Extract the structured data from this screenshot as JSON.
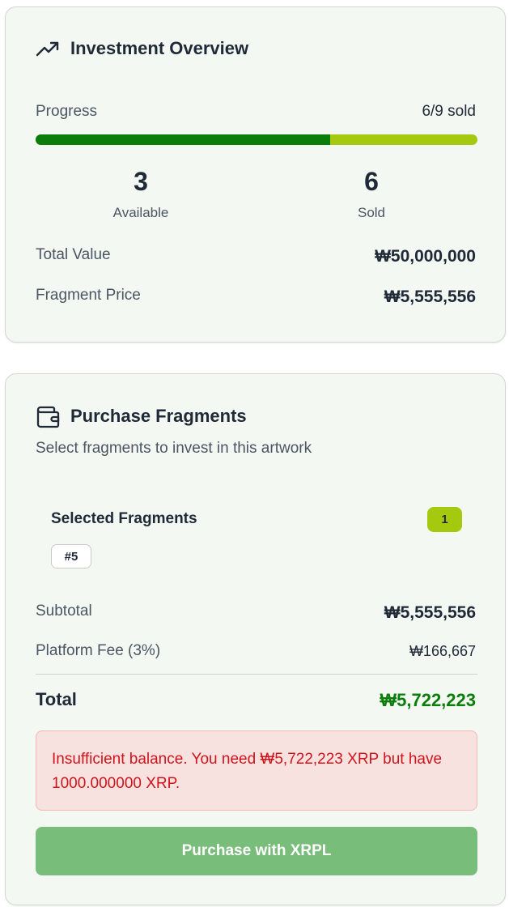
{
  "overview": {
    "icon": "trending-up-icon",
    "title": "Investment Overview",
    "progress_label": "Progress",
    "progress_text": "6/9 sold",
    "progress_fraction": 0.6667,
    "available_count": "3",
    "available_label": "Available",
    "sold_count": "6",
    "sold_label": "Sold",
    "total_value_label": "Total Value",
    "total_value": "₩50,000,000",
    "fragment_price_label": "Fragment Price",
    "fragment_price": "₩5,555,556",
    "colors": {
      "progress_sold": "#0a7d0a",
      "progress_remaining": "#a5c90f"
    }
  },
  "purchase": {
    "icon": "wallet-icon",
    "title": "Purchase Fragments",
    "subtitle": "Select fragments to invest in this artwork",
    "selected_label": "Selected Fragments",
    "selected_count": "1",
    "selected_fragments": [
      "#5"
    ],
    "subtotal_label": "Subtotal",
    "subtotal": "₩5,555,556",
    "fee_label": "Platform Fee (3%)",
    "fee": "₩166,667",
    "total_label": "Total",
    "total": "₩5,722,223",
    "error_message": "Insufficient balance. You need ₩5,722,223 XRP but have 1000.000000 XRP.",
    "button_label": "Purchase with XRPL",
    "colors": {
      "total": "#0a7d0a",
      "error_text": "#d0141b",
      "error_bg": "#f8e2e0",
      "button_bg": "#79bd7a",
      "badge": "#a5c90f"
    }
  }
}
